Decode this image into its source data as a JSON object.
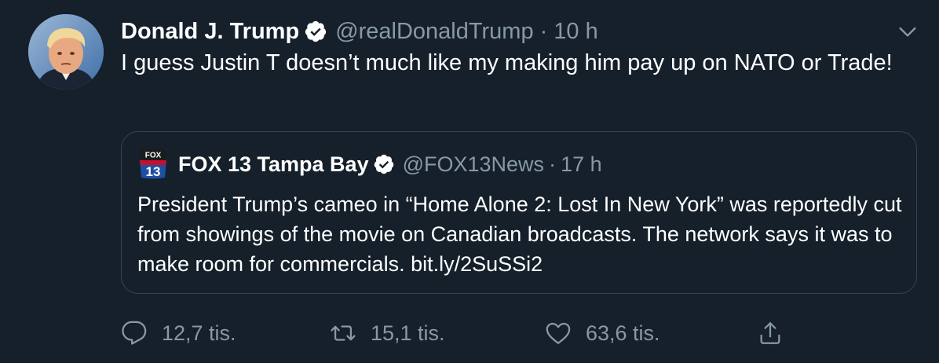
{
  "tweet": {
    "author": {
      "display_name": "Donald J. Trump",
      "handle": "@realDonaldTrump",
      "verified": true,
      "avatar": "profile-photo"
    },
    "separator": "·",
    "time": "10 h",
    "text": "I guess Justin T doesn’t much like my making him pay up on NATO or Trade!",
    "menu_icon": "chevron-down-icon"
  },
  "quoted_tweet": {
    "logo_text_top": "FOX",
    "logo_text_bottom": "13",
    "display_name": "FOX 13 Tampa Bay",
    "handle": "@FOX13News",
    "verified": true,
    "separator": "·",
    "time": "17 h",
    "text": "President Trump’s cameo in “Home Alone 2: Lost In New York” was reportedly cut from showings of the movie on Canadian broadcasts. The network says it was to make room for commercials. bit.ly/2SuSSi2"
  },
  "actions": {
    "reply": {
      "icon": "reply-icon",
      "count": "12,7 tis."
    },
    "retweet": {
      "icon": "retweet-icon",
      "count": "15,1 tis."
    },
    "like": {
      "icon": "heart-icon",
      "count": "63,6 tis."
    },
    "share": {
      "icon": "share-icon"
    }
  },
  "colors": {
    "background": "#15202b",
    "text_primary": "#ffffff",
    "text_secondary": "#8899a6",
    "border": "#38444d",
    "verified": "#ffffff"
  }
}
